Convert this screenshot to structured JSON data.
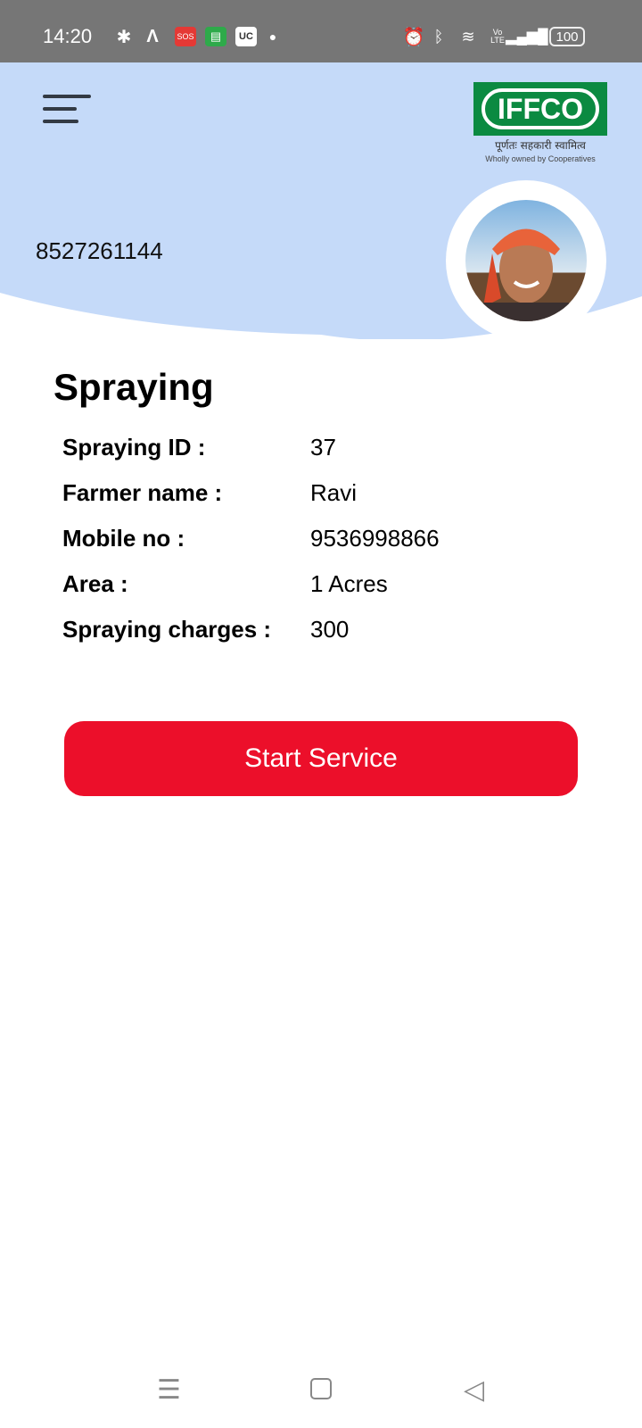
{
  "status_bar": {
    "time": "14:20",
    "battery": "100",
    "notif_icons": [
      "slack-icon",
      "app-icon",
      "sos-icon",
      "messages-icon",
      "uc-browser-icon"
    ],
    "right_icons": [
      "alarm-icon",
      "bluetooth-icon",
      "wifi-icon",
      "volte-icon",
      "signal-icon",
      "battery-icon"
    ],
    "sos": "SOS",
    "uc": "UC",
    "volte": "Vo LTE"
  },
  "header": {
    "phone": "8527261144",
    "logo": {
      "name": "IFFCO",
      "tagline_hi": "पूर्णतः सहकारी स्वामित्व",
      "tagline_en": "Wholly owned by Cooperatives"
    },
    "bg_color": "#c5daf9"
  },
  "section": {
    "title": "Spraying",
    "rows": [
      {
        "label": "Spraying ID :",
        "value": "37"
      },
      {
        "label": "Farmer name :",
        "value": "Ravi"
      },
      {
        "label": "Mobile no :",
        "value": "9536998866"
      },
      {
        "label": "Area :",
        "value": "1 Acres"
      },
      {
        "label": "Spraying charges :",
        "value": "300"
      }
    ]
  },
  "button": {
    "label": "Start Service",
    "color": "#ec0f2a"
  },
  "nav": {
    "items": [
      "menu",
      "home",
      "back"
    ]
  }
}
